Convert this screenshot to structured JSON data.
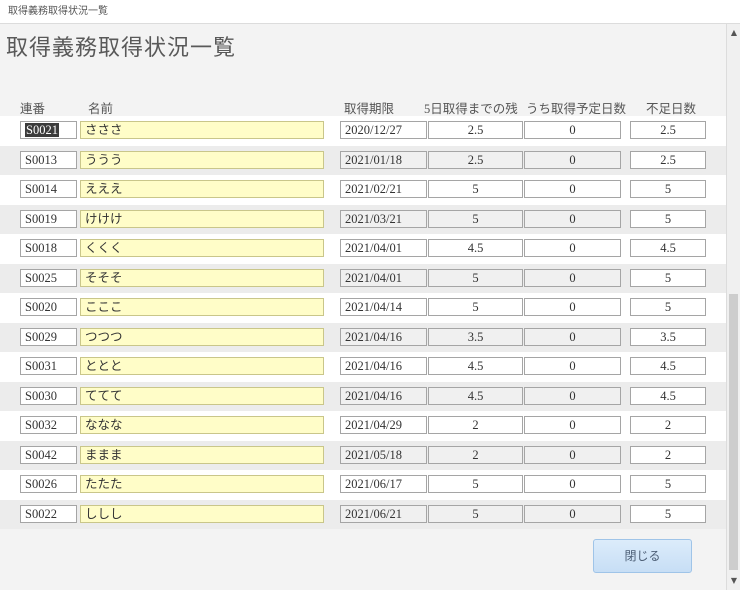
{
  "window": {
    "title": "取得義務取得状況一覧"
  },
  "form": {
    "heading": "取得義務取得状況一覧"
  },
  "columns": {
    "id": "連番",
    "name": "名前",
    "deadline": "取得期限",
    "remaining": "5日取得までの残",
    "planned": "うち取得予定日数",
    "shortage": "不足日数"
  },
  "rows": [
    {
      "id": "S0021",
      "name": "さささ",
      "deadline": "2020/12/27",
      "remaining": "2.5",
      "planned": "0",
      "shortage": "2.5"
    },
    {
      "id": "S0013",
      "name": "ううう",
      "deadline": "2021/01/18",
      "remaining": "2.5",
      "planned": "0",
      "shortage": "2.5"
    },
    {
      "id": "S0014",
      "name": "えええ",
      "deadline": "2021/02/21",
      "remaining": "5",
      "planned": "0",
      "shortage": "5"
    },
    {
      "id": "S0019",
      "name": "けけけ",
      "deadline": "2021/03/21",
      "remaining": "5",
      "planned": "0",
      "shortage": "5"
    },
    {
      "id": "S0018",
      "name": "くくく",
      "deadline": "2021/04/01",
      "remaining": "4.5",
      "planned": "0",
      "shortage": "4.5"
    },
    {
      "id": "S0025",
      "name": "そそそ",
      "deadline": "2021/04/01",
      "remaining": "5",
      "planned": "0",
      "shortage": "5"
    },
    {
      "id": "S0020",
      "name": "こここ",
      "deadline": "2021/04/14",
      "remaining": "5",
      "planned": "0",
      "shortage": "5"
    },
    {
      "id": "S0029",
      "name": "つつつ",
      "deadline": "2021/04/16",
      "remaining": "3.5",
      "planned": "0",
      "shortage": "3.5"
    },
    {
      "id": "S0031",
      "name": "ととと",
      "deadline": "2021/04/16",
      "remaining": "4.5",
      "planned": "0",
      "shortage": "4.5"
    },
    {
      "id": "S0030",
      "name": "ててて",
      "deadline": "2021/04/16",
      "remaining": "4.5",
      "planned": "0",
      "shortage": "4.5"
    },
    {
      "id": "S0032",
      "name": "ななな",
      "deadline": "2021/04/29",
      "remaining": "2",
      "planned": "0",
      "shortage": "2"
    },
    {
      "id": "S0042",
      "name": "ままま",
      "deadline": "2021/05/18",
      "remaining": "2",
      "planned": "0",
      "shortage": "2"
    },
    {
      "id": "S0026",
      "name": "たたた",
      "deadline": "2021/06/17",
      "remaining": "5",
      "planned": "0",
      "shortage": "5"
    },
    {
      "id": "S0022",
      "name": "ししし",
      "deadline": "2021/06/21",
      "remaining": "5",
      "planned": "0",
      "shortage": "5"
    }
  ],
  "buttons": {
    "close": "閉じる"
  },
  "icons": {
    "scroll_up": "scroll-up-arrow-icon",
    "scroll_down": "scroll-down-arrow-icon"
  }
}
